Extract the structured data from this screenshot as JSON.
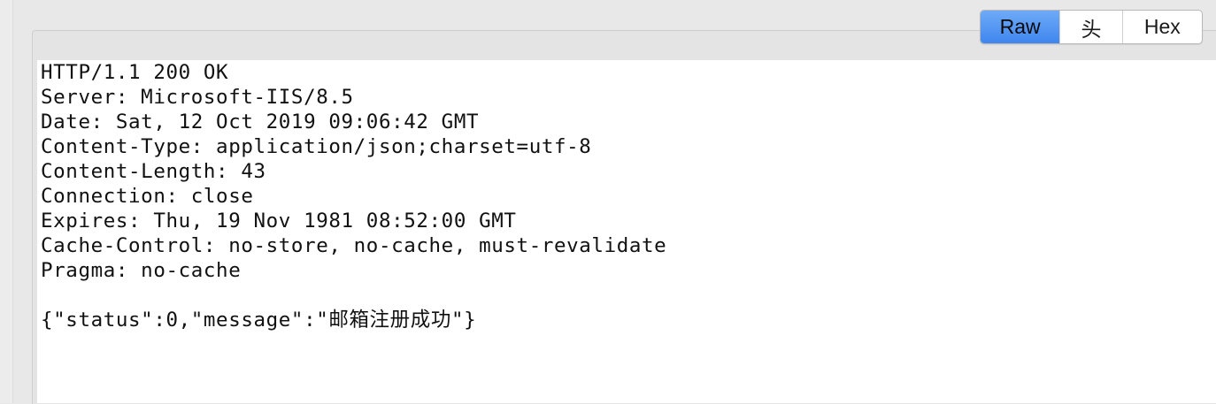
{
  "view_tabs": [
    {
      "label": "Raw",
      "active": true
    },
    {
      "label": "头",
      "active": false
    },
    {
      "label": "Hex",
      "active": false
    }
  ],
  "response": {
    "status_line": "HTTP/1.1 200 OK",
    "headers": [
      "Server: Microsoft-IIS/8.5",
      "Date: Sat, 12 Oct 2019 09:06:42 GMT",
      "Content-Type: application/json;charset=utf-8",
      "Content-Length: 43",
      "Connection: close",
      "Expires: Thu, 19 Nov 1981 08:52:00 GMT",
      "Cache-Control: no-store, no-cache, must-revalidate",
      "Pragma: no-cache"
    ],
    "body": "{\"status\":0,\"message\":\"邮箱注册成功\"}"
  },
  "colors": {
    "active_tab": "#4a8ff0",
    "background": "#e8e8e8",
    "text": "#111111"
  }
}
